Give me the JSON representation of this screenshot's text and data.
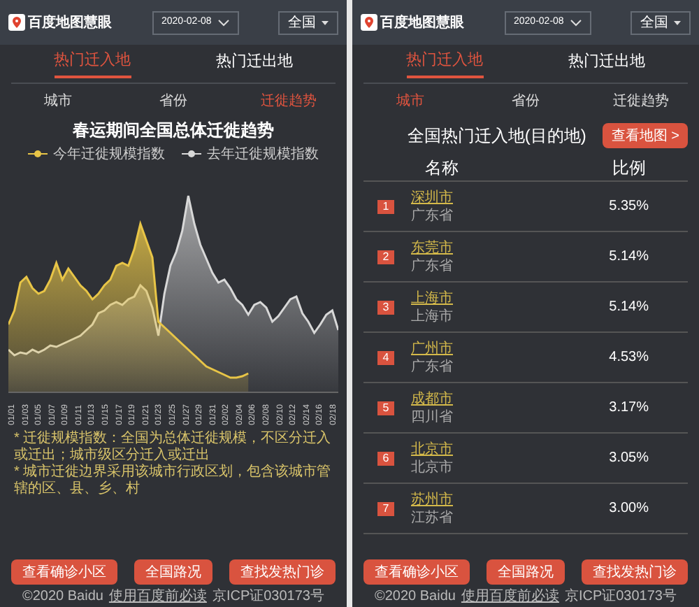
{
  "panels": [
    {
      "kind": "trend",
      "header": {
        "logo": "百度地图慧眼",
        "date": "2020-02-08",
        "region": "全国"
      },
      "tabs": [
        {
          "label": "热门迁入地",
          "selected": true
        },
        {
          "label": "热门迁出地",
          "selected": false
        }
      ],
      "subtabs": [
        {
          "label": "城市",
          "selected": false
        },
        {
          "label": "省份",
          "selected": false
        },
        {
          "label": "迁徙趋势",
          "selected": true
        }
      ],
      "title": "春运期间全国总体迁徙趋势",
      "legend": [
        {
          "label": "今年迁徙规模指数",
          "color": "#e8c547"
        },
        {
          "label": "去年迁徙规模指数",
          "color": "#d8d8d8"
        }
      ],
      "dates": [
        "01/01",
        "01/03",
        "01/05",
        "01/07",
        "01/09",
        "01/11",
        "01/13",
        "01/15",
        "01/17",
        "01/19",
        "01/21",
        "01/23",
        "01/25",
        "01/27",
        "01/29",
        "01/31",
        "02/02",
        "02/04",
        "02/06",
        "02/08",
        "02/10",
        "02/12",
        "02/14",
        "02/16",
        "02/18"
      ],
      "notes": [
        "* 迁徙规模指数：全国为总体迁徙规模，不区分迁入或迁出；城市级区分迁入或迁出",
        "* 城市迁徙边界采用该城市行政区划，包含该城市管辖的区、县、乡、村"
      ],
      "buttons": [
        "查看确诊小区",
        "全国路况",
        "查找发热门诊"
      ],
      "footer": {
        "copyright": "©2020 Baidu",
        "link": "使用百度前必读",
        "icp": "京ICP证030173号"
      }
    },
    {
      "kind": "ranking",
      "header": {
        "logo": "百度地图慧眼",
        "date": "2020-02-08",
        "region": "全国"
      },
      "tabs": [
        {
          "label": "热门迁入地",
          "selected": true
        },
        {
          "label": "热门迁出地",
          "selected": false
        }
      ],
      "subtabs": [
        {
          "label": "城市",
          "selected": true
        },
        {
          "label": "省份",
          "selected": false
        },
        {
          "label": "迁徙趋势",
          "selected": false
        }
      ],
      "title": "全国热门迁入地(目的地)",
      "map_button": "查看地图 >",
      "columns": [
        "名称",
        "比例"
      ],
      "rows": [
        {
          "rank": "1",
          "city": "深圳市",
          "province": "广东省",
          "share": "5.35%"
        },
        {
          "rank": "2",
          "city": "东莞市",
          "province": "广东省",
          "share": "5.14%"
        },
        {
          "rank": "3",
          "city": "上海市",
          "province": "上海市",
          "share": "5.14%"
        },
        {
          "rank": "4",
          "city": "广州市",
          "province": "广东省",
          "share": "4.53%"
        },
        {
          "rank": "5",
          "city": "成都市",
          "province": "四川省",
          "share": "3.17%"
        },
        {
          "rank": "6",
          "city": "北京市",
          "province": "北京市",
          "share": "3.05%"
        },
        {
          "rank": "7",
          "city": "苏州市",
          "province": "江苏省",
          "share": "3.00%"
        }
      ],
      "buttons": [
        "查看确诊小区",
        "全国路况",
        "查找发热门诊"
      ],
      "footer": {
        "copyright": "©2020 Baidu",
        "link": "使用百度前必读",
        "icp": "京ICP证030173号"
      }
    }
  ]
}
